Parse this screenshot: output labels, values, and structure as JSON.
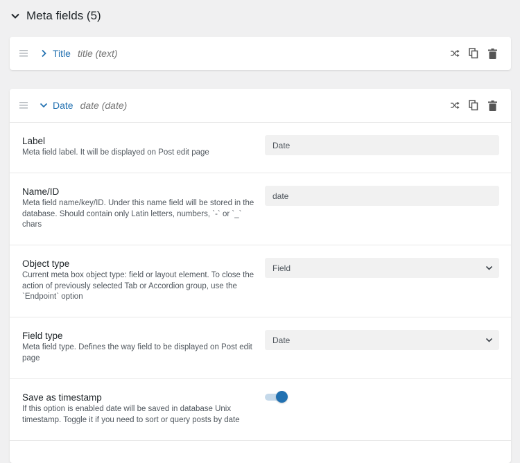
{
  "section": {
    "title": "Meta fields (5)"
  },
  "fields": [
    {
      "name": "Title",
      "slug": "title (text)",
      "expanded": false
    },
    {
      "name": "Date",
      "slug": "date (date)",
      "expanded": true
    }
  ],
  "date_settings": {
    "label": {
      "title": "Label",
      "description": "Meta field label. It will be displayed on Post edit page",
      "value": "Date"
    },
    "name_id": {
      "title": "Name/ID",
      "description": "Meta field name/key/ID. Under this name field will be stored in the database. Should contain only Latin letters, numbers, `-` or `_` chars",
      "value": "date"
    },
    "object_type": {
      "title": "Object type",
      "description": "Current meta box object type: field or layout element. To close the action of previously selected Tab or Accordion group, use the `Endpoint` option",
      "value": "Field"
    },
    "field_type": {
      "title": "Field type",
      "description": "Meta field type. Defines the way field to be displayed on Post edit page",
      "value": "Date"
    },
    "save_as_timestamp": {
      "title": "Save as timestamp",
      "description": "If this option is enabled date will be saved in database Unix timestamp. Toggle it if you need to sort or query posts by date",
      "enabled": true
    }
  },
  "colors": {
    "accent": "#2271b1",
    "toggle_track": "#c5d9ea",
    "input_bg": "#f1f1f1",
    "page_bg": "#f0f0f1"
  },
  "icons": {
    "section_toggle": "chevron-down-icon",
    "drag": "drag-handle-icon",
    "collapsed": "chevron-right-icon",
    "expanded": "chevron-down-icon",
    "shuffle": "shuffle-icon",
    "copy": "copy-icon",
    "delete": "trash-icon",
    "select": "chevron-down-icon"
  }
}
